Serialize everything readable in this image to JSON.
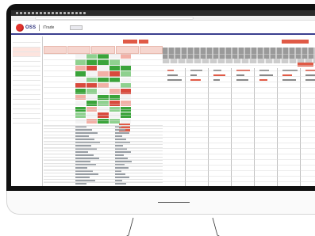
{
  "app": {
    "brand": "OSS",
    "product": "iTrade",
    "header_tab": "",
    "header_right": ""
  },
  "browser": {
    "tab_title": "",
    "url": ""
  },
  "sidebar": {
    "title": "",
    "rows": 18,
    "highlight_rows": [
      2,
      3
    ]
  },
  "colors": {
    "brand_navy": "#2a2f7a",
    "accent_red": "#e05a46",
    "matrix_green": "#3aa43a",
    "matrix_light_green": "#8fd18f",
    "matrix_red": "#d94a3d",
    "matrix_light_red": "#f2b0a6"
  },
  "matrix": [
    [
      "w",
      "lg",
      "g",
      "w",
      "lr"
    ],
    [
      "lg",
      "g",
      "g",
      "lg",
      "w"
    ],
    [
      "lr",
      "r",
      "w",
      "g",
      "g"
    ],
    [
      "g",
      "w",
      "lr",
      "r",
      "lg"
    ],
    [
      "w",
      "lg",
      "g",
      "g",
      "w"
    ],
    [
      "r",
      "r",
      "lr",
      "w",
      "lg"
    ],
    [
      "g",
      "lg",
      "w",
      "lr",
      "r"
    ],
    [
      "lr",
      "w",
      "g",
      "g",
      "w"
    ],
    [
      "w",
      "g",
      "lg",
      "r",
      "lr"
    ],
    [
      "g",
      "lr",
      "w",
      "lg",
      "g"
    ],
    [
      "lg",
      "w",
      "r",
      "w",
      "g"
    ],
    [
      "w",
      "lr",
      "g",
      "lg",
      "w"
    ]
  ]
}
